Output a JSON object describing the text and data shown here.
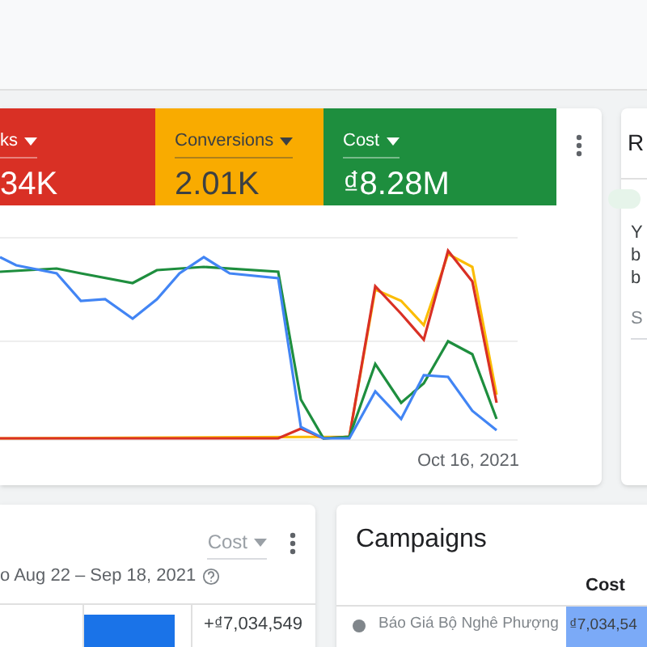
{
  "metrics": [
    {
      "label": "ks",
      "value": "34K",
      "color": "#d93025"
    },
    {
      "label": "Conversions",
      "value": "2.01K",
      "color": "#f9ab00"
    },
    {
      "label": "Cost",
      "value": "₫8.28M",
      "color": "#1e8e3e"
    }
  ],
  "chart": {
    "x_label": "Oct 16, 2021"
  },
  "side_card": {
    "title": "R",
    "lines": [
      "Y",
      "b",
      "b"
    ],
    "link": "S"
  },
  "change_card": {
    "dropdown": "Cost",
    "date_range": "o Aug 22 – Sep 18, 2021",
    "change": "+₫7,034,549"
  },
  "campaigns": {
    "title": "Campaigns",
    "column": "Cost",
    "rows": [
      {
        "name": "Báo Giá Bộ Nghê Phượng",
        "cost": "₫7,034,54"
      }
    ]
  }
}
